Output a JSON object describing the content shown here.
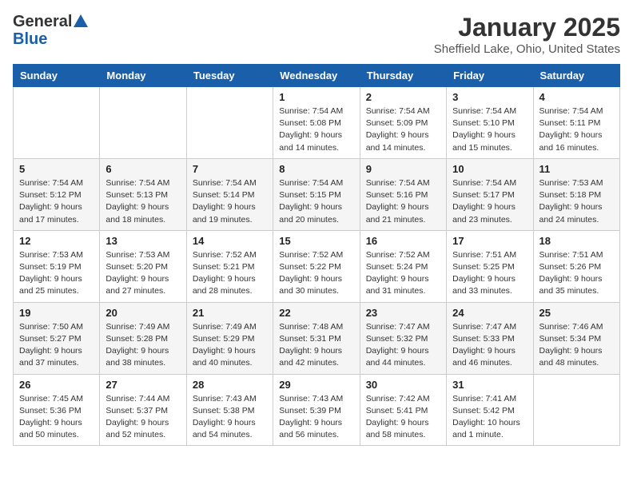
{
  "logo": {
    "line1": "General",
    "line2": "Blue"
  },
  "header": {
    "month": "January 2025",
    "location": "Sheffield Lake, Ohio, United States"
  },
  "days_of_week": [
    "Sunday",
    "Monday",
    "Tuesday",
    "Wednesday",
    "Thursday",
    "Friday",
    "Saturday"
  ],
  "weeks": [
    [
      {
        "day": "",
        "info": ""
      },
      {
        "day": "",
        "info": ""
      },
      {
        "day": "",
        "info": ""
      },
      {
        "day": "1",
        "info": "Sunrise: 7:54 AM\nSunset: 5:08 PM\nDaylight: 9 hours\nand 14 minutes."
      },
      {
        "day": "2",
        "info": "Sunrise: 7:54 AM\nSunset: 5:09 PM\nDaylight: 9 hours\nand 14 minutes."
      },
      {
        "day": "3",
        "info": "Sunrise: 7:54 AM\nSunset: 5:10 PM\nDaylight: 9 hours\nand 15 minutes."
      },
      {
        "day": "4",
        "info": "Sunrise: 7:54 AM\nSunset: 5:11 PM\nDaylight: 9 hours\nand 16 minutes."
      }
    ],
    [
      {
        "day": "5",
        "info": "Sunrise: 7:54 AM\nSunset: 5:12 PM\nDaylight: 9 hours\nand 17 minutes."
      },
      {
        "day": "6",
        "info": "Sunrise: 7:54 AM\nSunset: 5:13 PM\nDaylight: 9 hours\nand 18 minutes."
      },
      {
        "day": "7",
        "info": "Sunrise: 7:54 AM\nSunset: 5:14 PM\nDaylight: 9 hours\nand 19 minutes."
      },
      {
        "day": "8",
        "info": "Sunrise: 7:54 AM\nSunset: 5:15 PM\nDaylight: 9 hours\nand 20 minutes."
      },
      {
        "day": "9",
        "info": "Sunrise: 7:54 AM\nSunset: 5:16 PM\nDaylight: 9 hours\nand 21 minutes."
      },
      {
        "day": "10",
        "info": "Sunrise: 7:54 AM\nSunset: 5:17 PM\nDaylight: 9 hours\nand 23 minutes."
      },
      {
        "day": "11",
        "info": "Sunrise: 7:53 AM\nSunset: 5:18 PM\nDaylight: 9 hours\nand 24 minutes."
      }
    ],
    [
      {
        "day": "12",
        "info": "Sunrise: 7:53 AM\nSunset: 5:19 PM\nDaylight: 9 hours\nand 25 minutes."
      },
      {
        "day": "13",
        "info": "Sunrise: 7:53 AM\nSunset: 5:20 PM\nDaylight: 9 hours\nand 27 minutes."
      },
      {
        "day": "14",
        "info": "Sunrise: 7:52 AM\nSunset: 5:21 PM\nDaylight: 9 hours\nand 28 minutes."
      },
      {
        "day": "15",
        "info": "Sunrise: 7:52 AM\nSunset: 5:22 PM\nDaylight: 9 hours\nand 30 minutes."
      },
      {
        "day": "16",
        "info": "Sunrise: 7:52 AM\nSunset: 5:24 PM\nDaylight: 9 hours\nand 31 minutes."
      },
      {
        "day": "17",
        "info": "Sunrise: 7:51 AM\nSunset: 5:25 PM\nDaylight: 9 hours\nand 33 minutes."
      },
      {
        "day": "18",
        "info": "Sunrise: 7:51 AM\nSunset: 5:26 PM\nDaylight: 9 hours\nand 35 minutes."
      }
    ],
    [
      {
        "day": "19",
        "info": "Sunrise: 7:50 AM\nSunset: 5:27 PM\nDaylight: 9 hours\nand 37 minutes."
      },
      {
        "day": "20",
        "info": "Sunrise: 7:49 AM\nSunset: 5:28 PM\nDaylight: 9 hours\nand 38 minutes."
      },
      {
        "day": "21",
        "info": "Sunrise: 7:49 AM\nSunset: 5:29 PM\nDaylight: 9 hours\nand 40 minutes."
      },
      {
        "day": "22",
        "info": "Sunrise: 7:48 AM\nSunset: 5:31 PM\nDaylight: 9 hours\nand 42 minutes."
      },
      {
        "day": "23",
        "info": "Sunrise: 7:47 AM\nSunset: 5:32 PM\nDaylight: 9 hours\nand 44 minutes."
      },
      {
        "day": "24",
        "info": "Sunrise: 7:47 AM\nSunset: 5:33 PM\nDaylight: 9 hours\nand 46 minutes."
      },
      {
        "day": "25",
        "info": "Sunrise: 7:46 AM\nSunset: 5:34 PM\nDaylight: 9 hours\nand 48 minutes."
      }
    ],
    [
      {
        "day": "26",
        "info": "Sunrise: 7:45 AM\nSunset: 5:36 PM\nDaylight: 9 hours\nand 50 minutes."
      },
      {
        "day": "27",
        "info": "Sunrise: 7:44 AM\nSunset: 5:37 PM\nDaylight: 9 hours\nand 52 minutes."
      },
      {
        "day": "28",
        "info": "Sunrise: 7:43 AM\nSunset: 5:38 PM\nDaylight: 9 hours\nand 54 minutes."
      },
      {
        "day": "29",
        "info": "Sunrise: 7:43 AM\nSunset: 5:39 PM\nDaylight: 9 hours\nand 56 minutes."
      },
      {
        "day": "30",
        "info": "Sunrise: 7:42 AM\nSunset: 5:41 PM\nDaylight: 9 hours\nand 58 minutes."
      },
      {
        "day": "31",
        "info": "Sunrise: 7:41 AM\nSunset: 5:42 PM\nDaylight: 10 hours\nand 1 minute."
      },
      {
        "day": "",
        "info": ""
      }
    ]
  ]
}
